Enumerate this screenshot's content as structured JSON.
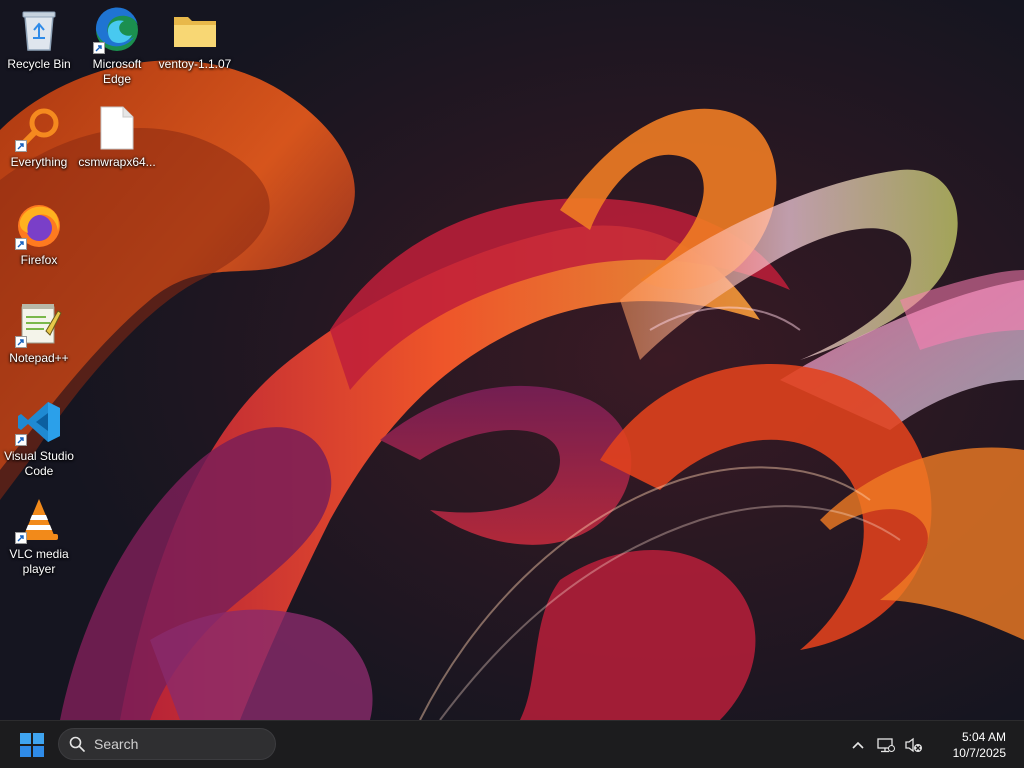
{
  "desktop": {
    "icons": [
      {
        "label": "Recycle Bin",
        "icon": "recycle-bin-icon",
        "shortcut": false
      },
      {
        "label": "Microsoft Edge",
        "icon": "edge-icon",
        "shortcut": true
      },
      {
        "label": "ventoy-1.1.07",
        "icon": "folder-icon",
        "shortcut": false
      },
      {
        "label": "Everything",
        "icon": "everything-search-icon",
        "shortcut": true
      },
      {
        "label": "csmwrapx64...",
        "icon": "file-icon",
        "shortcut": false
      },
      {
        "label": "Firefox",
        "icon": "firefox-icon",
        "shortcut": true
      },
      {
        "label": "Notepad++",
        "icon": "notepad-plus-plus-icon",
        "shortcut": true
      },
      {
        "label": "Visual Studio Code",
        "icon": "vscode-icon",
        "shortcut": true
      },
      {
        "label": "VLC media player",
        "icon": "vlc-icon",
        "shortcut": true
      }
    ]
  },
  "taskbar": {
    "start_icon": "windows-start-icon",
    "search": {
      "label": "Search",
      "icon": "search-icon"
    },
    "tray": {
      "overflow_icon": "chevron-up-icon",
      "network_icon": "network-disconnected-icon",
      "volume_icon": "volume-muted-icon",
      "time": "5:04 AM",
      "date": "10/7/2025"
    }
  },
  "colors": {
    "taskbar_bg": "#1c1c1e",
    "desktop_bg": "#161622",
    "windows_blue": "#2f8be8",
    "wallpaper_accents": [
      "#e2421c",
      "#f07c24",
      "#c01f3a",
      "#8a2a6b",
      "#ff7fb4",
      "#d8e070"
    ]
  }
}
